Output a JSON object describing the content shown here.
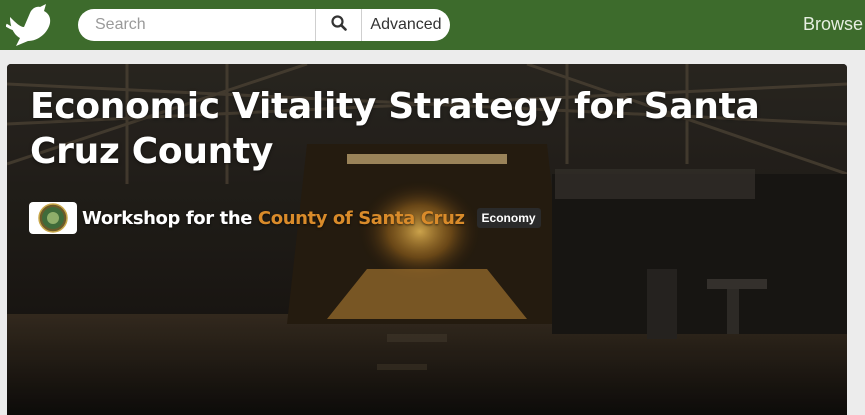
{
  "header": {
    "logo_icon": "dove-logo-icon",
    "search": {
      "placeholder": "Search",
      "value": ""
    },
    "search_icon": "magnifier-icon",
    "advanced_label": "Advanced",
    "browse_label": "Browse",
    "colors": {
      "bar": "#3d6b2c"
    }
  },
  "hero": {
    "title": "Economic Vitality Strategy for Santa Cruz County",
    "byline_prefix": "Workshop for the",
    "organization": "County of Santa Cruz",
    "organization_icon": "county-seal-icon",
    "tag": "Economy",
    "background": "night boardwalk passage photo",
    "colors": {
      "link": "#d98b2a",
      "tag_bg": "#2a2a2a"
    }
  }
}
